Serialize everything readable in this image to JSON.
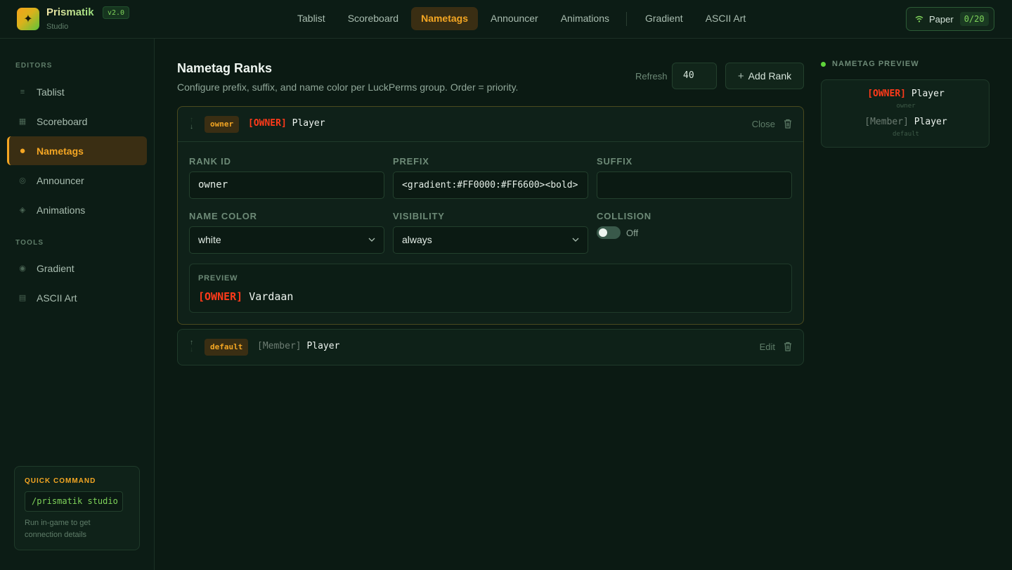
{
  "app": {
    "name": "Prismatik",
    "version": "v2.0",
    "subtitle": "Studio"
  },
  "nav": {
    "items": [
      {
        "label": "Tablist",
        "active": false
      },
      {
        "label": "Scoreboard",
        "active": false
      },
      {
        "label": "Nametags",
        "active": true
      },
      {
        "label": "Announcer",
        "active": false
      },
      {
        "label": "Animations",
        "active": false
      },
      {
        "label": "Gradient",
        "active": false
      },
      {
        "label": "ASCII Art",
        "active": false
      }
    ]
  },
  "server": {
    "name": "Paper",
    "count": "0/20",
    "icon": "wifi-icon"
  },
  "sidebar": {
    "sections": {
      "editors": "EDITORS",
      "tools": "TOOLS"
    },
    "editors": [
      {
        "label": "Tablist",
        "icon": "list-icon"
      },
      {
        "label": "Scoreboard",
        "icon": "grid-icon"
      },
      {
        "label": "Nametags",
        "icon": "circle-icon",
        "active": true
      },
      {
        "label": "Announcer",
        "icon": "ring-icon"
      },
      {
        "label": "Animations",
        "icon": "diamond-icon"
      }
    ],
    "tools": [
      {
        "label": "Gradient",
        "icon": "target-icon"
      },
      {
        "label": "ASCII Art",
        "icon": "grid-icon"
      }
    ],
    "quick_command": {
      "title": "QUICK COMMAND",
      "command": "/prismatik studio",
      "note": "Run in-game to get connection details"
    }
  },
  "main": {
    "title": "Nametag Ranks",
    "subtitle": "Configure prefix, suffix, and name color per LuckPerms group. Order = priority.",
    "refresh_label": "Refresh",
    "refresh_value": "40",
    "add_rank_label": "Add Rank",
    "ranks": [
      {
        "id": "owner",
        "prefix_display": "[OWNER]",
        "player": "Player",
        "action": "Close",
        "expanded": true,
        "fields": {
          "rank_id_label": "RANK ID",
          "rank_id": "owner",
          "prefix_label": "PREFIX",
          "prefix": "<gradient:#FF0000:#FF6600><bold>",
          "suffix_label": "SUFFIX",
          "suffix": "",
          "name_color_label": "NAME COLOR",
          "name_color": "white",
          "visibility_label": "VISIBILITY",
          "visibility": "always",
          "collision_label": "COLLISION",
          "collision": "Off"
        },
        "preview_label": "PREVIEW",
        "preview_tag": "[OWNER]",
        "preview_name": "Vardaan"
      },
      {
        "id": "default",
        "prefix_display": "[Member]",
        "player": "Player",
        "action": "Edit",
        "expanded": false
      }
    ]
  },
  "nametag_preview": {
    "title": "NAMETAG PREVIEW",
    "entries": [
      {
        "tag": "[OWNER]",
        "name": "Player",
        "group": "owner"
      },
      {
        "tag": "[Member]",
        "name": "Player",
        "group": "default"
      }
    ]
  },
  "colors": {
    "accent": "#f4a623",
    "success": "#7fd35a",
    "owner_tag": "#ff3a1a",
    "background": "#0b1a13"
  }
}
